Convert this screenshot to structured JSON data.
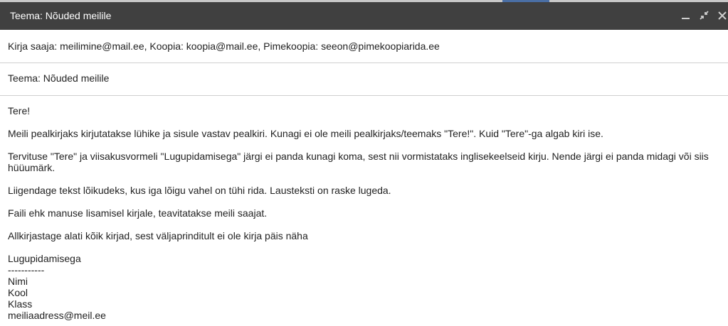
{
  "window": {
    "title": "Teema: Nõuded meilile"
  },
  "controls": {
    "minimize_icon": "minimize-icon",
    "popout_icon": "popout-icon",
    "close_icon": "close-icon"
  },
  "recipients": {
    "text": "Kirja saaja: meilimine@mail.ee, Koopia: koopia@mail.ee, Pimekoopia: seeon@pimekoopiarida.ee"
  },
  "subject": {
    "text": "Teema: Nõuded meilile"
  },
  "body": {
    "greeting": "Tere!",
    "paragraphs": [
      "Meili pealkirjaks kirjutatakse lühike ja sisule vastav pealkiri. Kunagi ei ole meili pealkirjaks/teemaks \"Tere!\". Kuid \"Tere\"-ga algab kiri ise.",
      "Tervituse \"Tere\" ja viisakusvormeli \"Lugupidamisega\" järgi ei panda kunagi koma, sest nii vormistataks inglisekeelseid kirju. Nende järgi ei panda midagi või siis hüüumärk.",
      "Liigendage tekst lõikudeks, kus iga lõigu vahel on tühi rida. Lausteksti on raske lugeda.",
      "Faili ehk manuse lisamisel kirjale, teavitatakse meili saajat.",
      "Allkirjastage alati kõik kirjad, sest väljaprinditult ei ole kirja päis näha"
    ],
    "signature": {
      "closing": "Lugupidamisega",
      "separator": "-----------",
      "name": "Nimi",
      "school": "Kool",
      "class": "Klass",
      "email": "meiliaadress@meil.ee"
    }
  },
  "colors": {
    "titlebar": "#404040",
    "title_text": "#ffffff",
    "divider": "#cfcfcf",
    "body_text": "#222222"
  }
}
